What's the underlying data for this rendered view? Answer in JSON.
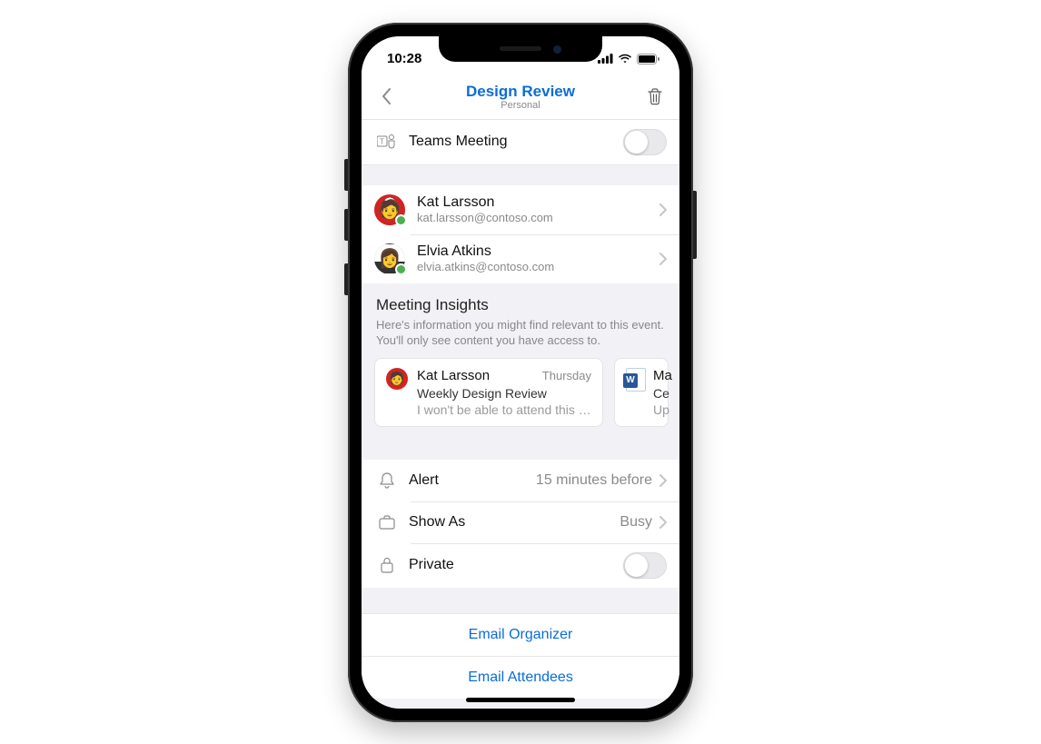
{
  "statusbar": {
    "time": "10:28"
  },
  "nav": {
    "title": "Design Review",
    "subtitle": "Personal"
  },
  "teams_row": {
    "label": "Teams Meeting",
    "enabled": false
  },
  "attendees": [
    {
      "name": "Kat Larsson",
      "email": "kat.larsson@contoso.com"
    },
    {
      "name": "Elvia Atkins",
      "email": "elvia.atkins@contoso.com"
    }
  ],
  "insights": {
    "title": "Meeting Insights",
    "description": "Here's information you might find relevant to this event. You'll only see content you have access to."
  },
  "cards": [
    {
      "sender": "Kat Larsson",
      "date": "Thursday",
      "subject": "Weekly Design Review",
      "preview": "I won't be able to attend this w…"
    },
    {
      "title_prefix": "Ma",
      "line2": "Ce",
      "line3": "Up"
    }
  ],
  "settings": {
    "alert": {
      "label": "Alert",
      "value": "15 minutes before"
    },
    "showas": {
      "label": "Show As",
      "value": "Busy"
    },
    "private": {
      "label": "Private",
      "enabled": false
    }
  },
  "actions": {
    "email_organizer": "Email Organizer",
    "email_attendees": "Email Attendees"
  }
}
